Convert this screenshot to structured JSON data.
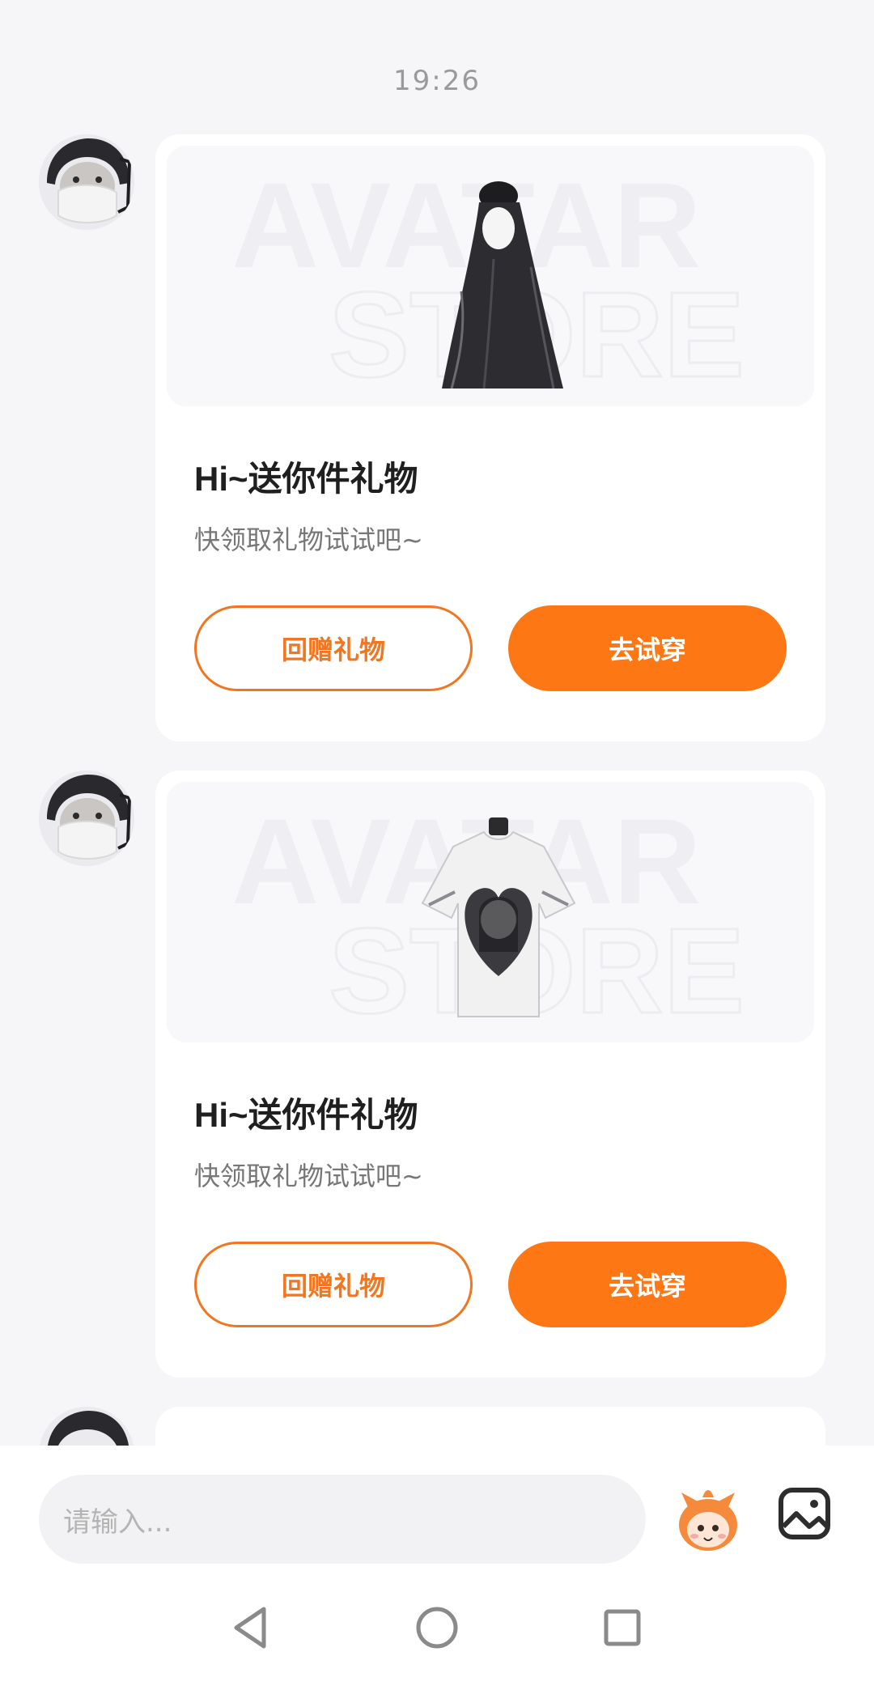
{
  "header": {
    "time": "19:26"
  },
  "messages": [
    {
      "item_icon": "hair-item-icon",
      "watermark_line1": "AVATAR",
      "watermark_line2": "STORE",
      "title": "Hi~送你件礼物",
      "subtitle": "快领取礼物试试吧~",
      "return_label": "回赠礼物",
      "try_label": "去试穿"
    },
    {
      "item_icon": "tshirt-item-icon",
      "watermark_line1": "AVATAR",
      "watermark_line2": "STORE",
      "title": "Hi~送你件礼物",
      "subtitle": "快领取礼物试试吧~",
      "return_label": "回赠礼物",
      "try_label": "去试穿"
    }
  ],
  "composer": {
    "placeholder": "请输入..."
  },
  "colors": {
    "accent": "#fd7714",
    "background": "#f6f6f9",
    "card": "#ffffff"
  }
}
